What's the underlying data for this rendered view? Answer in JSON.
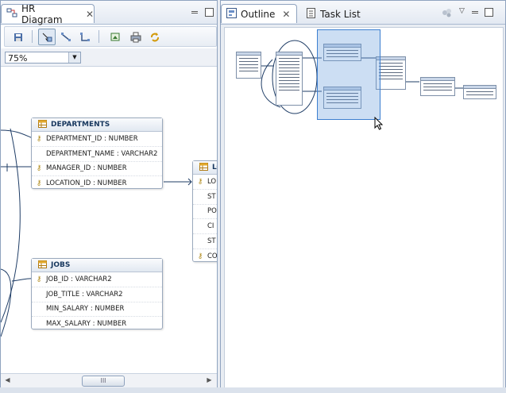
{
  "left_pane": {
    "tab": {
      "title": "HR Diagram",
      "icon": "diagram-icon",
      "close_icon": "close-icon"
    },
    "toolbar": {
      "icons": [
        "save-icon",
        "select-icon",
        "relation-icon",
        "connector-icon",
        "export-image-icon",
        "print-icon",
        "refresh-icon"
      ]
    },
    "zoom": {
      "value": "75%"
    },
    "tables": {
      "departments": {
        "name": "DEPARTMENTS",
        "columns": [
          "DEPARTMENT_ID : NUMBER",
          "DEPARTMENT_NAME : VARCHAR2",
          "MANAGER_ID : NUMBER",
          "LOCATION_ID : NUMBER"
        ]
      },
      "jobs": {
        "name": "JOBS",
        "columns": [
          "JOB_ID : VARCHAR2",
          "JOB_TITLE : VARCHAR2",
          "MIN_SALARY : NUMBER",
          "MAX_SALARY : NUMBER"
        ]
      },
      "locations": {
        "name": "LO",
        "columns": [
          "LO",
          "ST",
          "PO",
          "CI",
          "ST",
          "CO"
        ]
      }
    },
    "scrollbar": {
      "thumb_label": "III"
    }
  },
  "right_pane": {
    "tabs": [
      {
        "title": "Outline",
        "icon": "outline-icon"
      },
      {
        "title": "Task List",
        "icon": "task-list-icon"
      }
    ]
  },
  "colors": {
    "accent": "#3d7fd0",
    "header_text": "#17375e",
    "border": "#8fa3bf"
  }
}
